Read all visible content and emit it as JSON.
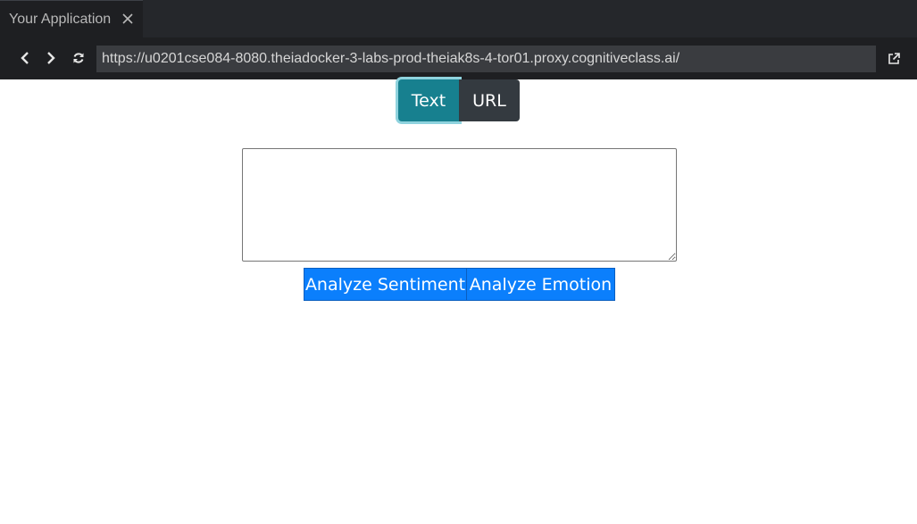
{
  "tab": {
    "title": "Your Application",
    "close_icon": "close-icon"
  },
  "nav": {
    "back_icon": "chevron-left-icon",
    "forward_icon": "chevron-right-icon",
    "reload_icon": "reload-icon",
    "url": "https://u0201cse084-8080.theiadocker-3-labs-prod-theiak8s-4-tor01.proxy.cognitiveclass.ai/",
    "open_external_icon": "external-link-icon"
  },
  "input_mode": {
    "options": [
      "Text",
      "URL"
    ],
    "selected": "Text"
  },
  "text_input": {
    "value": "",
    "placeholder": ""
  },
  "actions": {
    "sentiment_label": "Analyze Sentiment",
    "emotion_label": "Analyze Emotion"
  },
  "colors": {
    "selected_toggle": "#17808f",
    "unselected_toggle": "#343a40",
    "action_button": "#0b7ffc"
  }
}
